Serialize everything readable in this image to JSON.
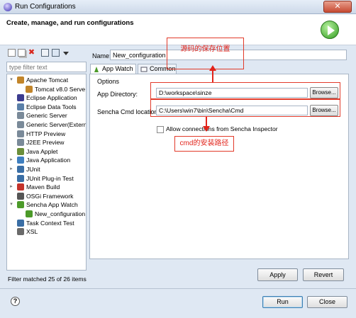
{
  "window": {
    "title": "Run Configurations",
    "close_glyph": "✕"
  },
  "header": {
    "heading": "Create, manage, and run configurations"
  },
  "toolbar": {
    "icons": [
      "new-config-icon",
      "duplicate-icon",
      "delete-icon",
      "collapse-all-icon",
      "filter-icon",
      "view-menu-icon"
    ],
    "delete_glyph": "✖"
  },
  "filter": {
    "placeholder": "type filter text"
  },
  "tree": {
    "items": [
      {
        "label": "Apache Tomcat",
        "expand": "▾",
        "icon": "tomcat-icon",
        "color": "#c2852a"
      },
      {
        "label": "Tomcat v8.0 Serve",
        "expand": "",
        "icon": "tomcat-icon",
        "color": "#c2852a"
      },
      {
        "label": "Eclipse Application",
        "expand": "",
        "icon": "eclipse-icon",
        "color": "#3b3b8f"
      },
      {
        "label": "Eclipse Data Tools",
        "expand": "",
        "icon": "data-tools-icon",
        "color": "#5a7fa8"
      },
      {
        "label": "Generic Server",
        "expand": "",
        "icon": "server-icon",
        "color": "#7a8a99"
      },
      {
        "label": "Generic Server(Extern",
        "expand": "",
        "icon": "server-icon",
        "color": "#7a8a99"
      },
      {
        "label": "HTTP Preview",
        "expand": "",
        "icon": "http-icon",
        "color": "#7a8a99"
      },
      {
        "label": "J2EE Preview",
        "expand": "",
        "icon": "j2ee-icon",
        "color": "#7a8a99"
      },
      {
        "label": "Java Applet",
        "expand": "",
        "icon": "applet-icon",
        "color": "#6b8e3a"
      },
      {
        "label": "Java Application",
        "expand": "▸",
        "icon": "java-app-icon",
        "color": "#3f7fbf"
      },
      {
        "label": "JUnit",
        "expand": "▸",
        "icon": "junit-icon",
        "color": "#3a6ea5"
      },
      {
        "label": "JUnit Plug-in Test",
        "expand": "",
        "icon": "junit-plugin-icon",
        "color": "#3a6ea5"
      },
      {
        "label": "Maven Build",
        "expand": "▸",
        "icon": "maven-icon",
        "color": "#c3332b"
      },
      {
        "label": "OSGi Framework",
        "expand": "",
        "icon": "osgi-icon",
        "color": "#555555"
      },
      {
        "label": "Sencha App Watch",
        "expand": "▾",
        "icon": "sencha-icon",
        "color": "#4c9a2a"
      },
      {
        "label": "New_configuration",
        "expand": "",
        "icon": "sencha-icon",
        "color": "#4c9a2a"
      },
      {
        "label": "Task Context Test",
        "expand": "",
        "icon": "task-context-icon",
        "color": "#3a6ea5"
      },
      {
        "label": "XSL",
        "expand": "",
        "icon": "xsl-icon",
        "color": "#6a6a6a"
      }
    ],
    "matched": "Filter matched 25 of 26 items"
  },
  "config": {
    "name_label": "Name:",
    "name_value": "New_configuration",
    "tabs": [
      {
        "label": "App Watch",
        "icon": "sencha-icon"
      },
      {
        "label": "Common",
        "icon": "common-tab-icon"
      }
    ],
    "options_label": "Options",
    "app_dir_label": "App Directory:",
    "app_dir_value": "D:\\workspace\\sinze",
    "sencha_label": "Sencha Cmd location:",
    "sencha_value": "C:\\Users\\win7\\bin\\Sencha\\Cmd",
    "browse_label": "Browse...",
    "inspector_label": "Allow connections from Sencha Inspector",
    "inspector_checked": false
  },
  "buttons": {
    "apply": "Apply",
    "revert": "Revert",
    "run": "Run",
    "close": "Close",
    "help": "?"
  },
  "annotations": {
    "code_location": "源码的保存位置",
    "cmd_path": "cmd的安装路径",
    "color": "#e2231a"
  }
}
